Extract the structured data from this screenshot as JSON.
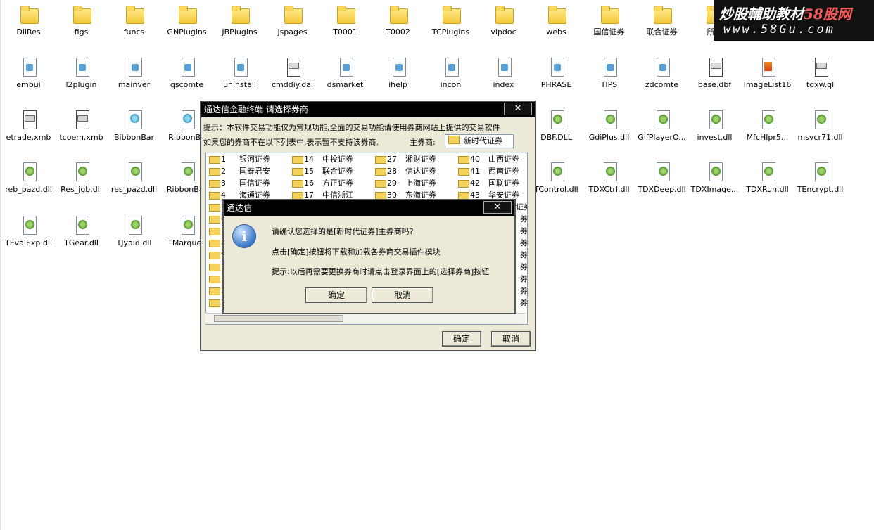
{
  "watermark": {
    "line1": "炒股輔助教材",
    "line1_accent": "58股网",
    "line2": "www.58Gu.com"
  },
  "desktop_files": [
    {
      "name": "DllRes",
      "icon": "folder"
    },
    {
      "name": "figs",
      "icon": "folder"
    },
    {
      "name": "funcs",
      "icon": "folder"
    },
    {
      "name": "GNPlugins",
      "icon": "folder"
    },
    {
      "name": "JBPlugins",
      "icon": "folder"
    },
    {
      "name": "jspages",
      "icon": "folder"
    },
    {
      "name": "T0001",
      "icon": "folder"
    },
    {
      "name": "T0002",
      "icon": "folder"
    },
    {
      "name": "TCPlugins",
      "icon": "folder"
    },
    {
      "name": "vipdoc",
      "icon": "folder"
    },
    {
      "name": "webs",
      "icon": "folder"
    },
    {
      "name": "国信证券",
      "icon": "folder"
    },
    {
      "name": "联合证券",
      "icon": "folder"
    },
    {
      "name": "所有",
      "icon": "folder"
    },
    {
      "name": "embui",
      "icon": "doc"
    },
    {
      "name": "l2plugin",
      "icon": "doc"
    },
    {
      "name": "mainver",
      "icon": "doc"
    },
    {
      "name": "qscomte",
      "icon": "doc"
    },
    {
      "name": "uninstall",
      "icon": "doc"
    },
    {
      "name": "cmddiy.dai",
      "icon": "cfg"
    },
    {
      "name": "dsmarket",
      "icon": "doc"
    },
    {
      "name": "ihelp",
      "icon": "doc"
    },
    {
      "name": "incon",
      "icon": "doc"
    },
    {
      "name": "index",
      "icon": "doc"
    },
    {
      "name": "PHRASE",
      "icon": "doc"
    },
    {
      "name": "TIPS",
      "icon": "doc"
    },
    {
      "name": "zdcomte",
      "icon": "doc"
    },
    {
      "name": "base.dbf",
      "icon": "cfg"
    },
    {
      "name": "ImageList16",
      "icon": "img"
    },
    {
      "name": "tdxw.ql",
      "icon": "cfg"
    },
    {
      "name": "etrade.xmb",
      "icon": "cfg"
    },
    {
      "name": "tcoem.xmb",
      "icon": "cfg"
    },
    {
      "name": "BibbonBar",
      "icon": "web"
    },
    {
      "name": "RibbonBa",
      "icon": "web"
    },
    {
      "name": "DBF.DLL",
      "icon": "dll"
    },
    {
      "name": "GdiPlus.dll",
      "icon": "dll"
    },
    {
      "name": "GifPlayerO...",
      "icon": "dll"
    },
    {
      "name": "invest.dll",
      "icon": "dll"
    },
    {
      "name": "MfcHlpr5...",
      "icon": "dll"
    },
    {
      "name": "msvcr71.dll",
      "icon": "dll"
    },
    {
      "name": "reb_pazd.dll",
      "icon": "dll"
    },
    {
      "name": "Res_jgb.dll",
      "icon": "dll"
    },
    {
      "name": "res_pazd.dll",
      "icon": "dll"
    },
    {
      "name": "RibbonBar",
      "icon": "dll"
    },
    {
      "name": "TControl.dll",
      "icon": "dll"
    },
    {
      "name": "TDXCtrl.dll",
      "icon": "dll"
    },
    {
      "name": "TDXDeep.dll",
      "icon": "dll"
    },
    {
      "name": "TDXImage...",
      "icon": "dll"
    },
    {
      "name": "TDXRun.dll",
      "icon": "dll"
    },
    {
      "name": "TEncrypt.dll",
      "icon": "dll"
    },
    {
      "name": "TEvalExp.dll",
      "icon": "dll"
    },
    {
      "name": "TGear.dll",
      "icon": "dll"
    },
    {
      "name": "TJyaid.dll",
      "icon": "dll"
    },
    {
      "name": "TMarquee",
      "icon": "dll"
    }
  ],
  "broker_window": {
    "title": "通达信金融终端 请选择券商",
    "close_label": "✕",
    "hint1": "提示：本软件交易功能仅为常规功能,全面的交易功能请使用券商网站上提供的交易软件",
    "hint2": "如果您的券商不在以下列表中,表示暂不支持该券商.",
    "main_broker_label": "主券商:",
    "main_broker_value": "新时代证券",
    "brokers": [
      {
        "num": "1",
        "name": "银河证券"
      },
      {
        "num": "14",
        "name": "中投证券"
      },
      {
        "num": "27",
        "name": "湘财证券"
      },
      {
        "num": "40",
        "name": "山西证券"
      },
      {
        "num": "2",
        "name": "国泰君安"
      },
      {
        "num": "15",
        "name": "联合证券"
      },
      {
        "num": "28",
        "name": "信达证券"
      },
      {
        "num": "41",
        "name": "西南证券"
      },
      {
        "num": "3",
        "name": "国信证券"
      },
      {
        "num": "16",
        "name": "方正证券"
      },
      {
        "num": "29",
        "name": "上海证券"
      },
      {
        "num": "42",
        "name": "国联证券"
      },
      {
        "num": "4",
        "name": "海通证券"
      },
      {
        "num": "17",
        "name": "中信浙江"
      },
      {
        "num": "30",
        "name": "东海证券"
      },
      {
        "num": "43",
        "name": "华安证券"
      }
    ],
    "partial_rows": [
      "5",
      "6",
      "7",
      "8",
      "9",
      "1",
      "1",
      "1",
      "1"
    ],
    "right_partial": [
      "证券",
      "券",
      "券",
      "券",
      "券",
      "券",
      "券",
      "券",
      "券"
    ],
    "ok_label": "确定",
    "cancel_label": "取消"
  },
  "confirm_dialog": {
    "title": "通达信",
    "close_label": "✕",
    "icon_glyph": "i",
    "line1": "请确认您选择的是[新时代证券]主券商吗?",
    "line2": "点击[确定]按钮将下载和加载各券商交易插件模块",
    "line3": "提示:以后再需要更换券商时请点击登录界面上的[选择券商]按钮",
    "ok_label": "确定",
    "cancel_label": "取消"
  }
}
